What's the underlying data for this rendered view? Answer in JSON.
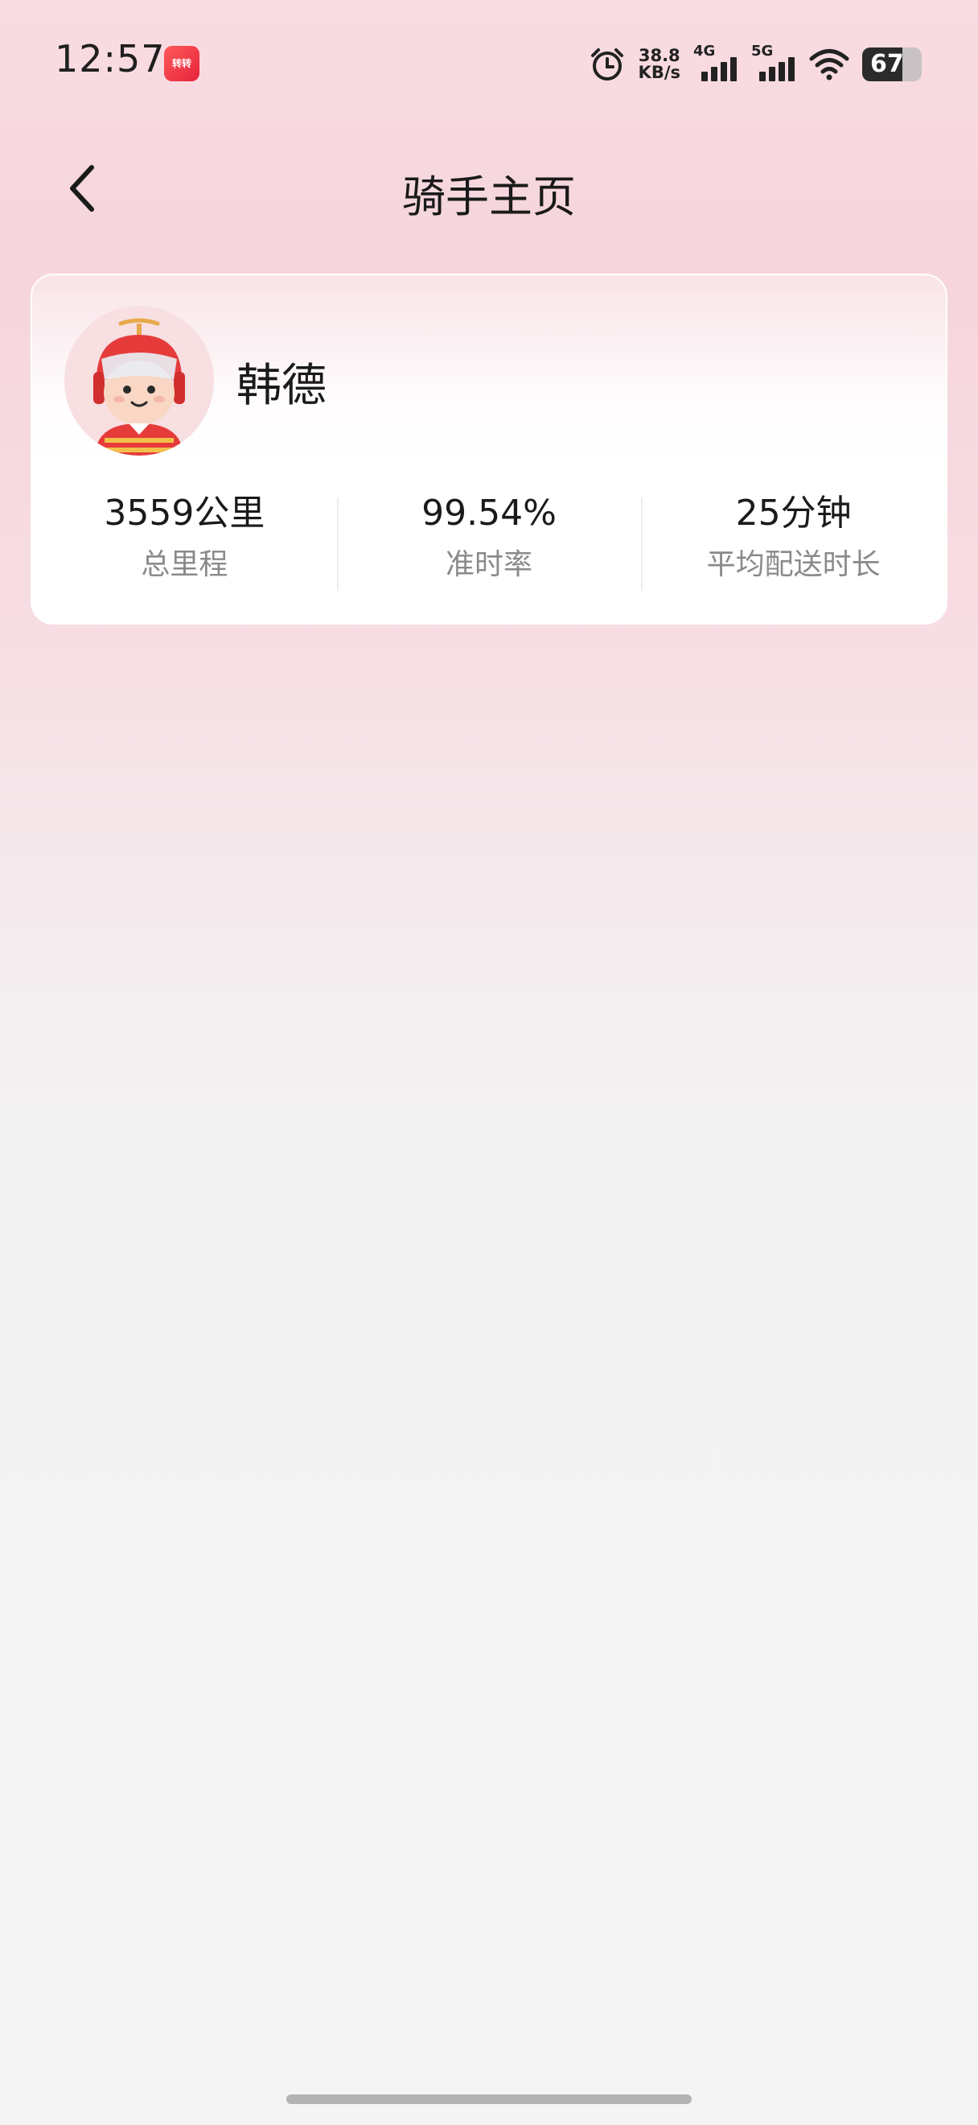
{
  "status_bar": {
    "time": "12:57",
    "app_icon_label": "转转",
    "net_speed_value": "38.8",
    "net_speed_unit": "KB/s",
    "signal_1_label": "4G",
    "signal_2_label": "5G",
    "battery_level": "67",
    "icons": [
      "app-notification-icon",
      "alarm-icon",
      "signal-icon",
      "wifi-icon",
      "battery-icon"
    ]
  },
  "header": {
    "title": "骑手主页",
    "back_icon": "chevron-left-icon"
  },
  "rider": {
    "name": "韩德",
    "avatar_icon": "rider-avatar-icon",
    "stats": [
      {
        "value": "3559公里",
        "label": "总里程"
      },
      {
        "value": "99.54%",
        "label": "准时率"
      },
      {
        "value": "25分钟",
        "label": "平均配送时长"
      }
    ]
  },
  "colors": {
    "background_top": "#f8dce2",
    "background_bottom": "#f4f4f4",
    "text_primary": "#1a1a1a",
    "text_secondary": "#8a8a8a",
    "avatar_accent": "#e63b3b"
  }
}
